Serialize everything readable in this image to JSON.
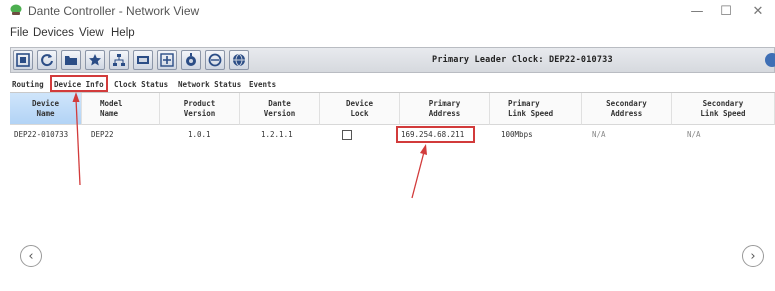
{
  "window": {
    "title": "Dante Controller - Network View",
    "minimize_glyph": "—",
    "maximize_glyph": "☐",
    "close_glyph": "✕"
  },
  "menu": [
    "File",
    "Devices",
    "View",
    "Help"
  ],
  "toolbar": {
    "leader_clock": "Primary Leader Clock: DEP22-010733",
    "buttons": [
      "device-view-icon",
      "refresh-icon",
      "folder-icon",
      "favorite-star-icon",
      "network-tree-icon",
      "presets-icon",
      "add-icon",
      "domain-icon",
      "clock-icon",
      "globe-icon"
    ]
  },
  "tabs": [
    "Routing",
    "Device Info",
    "Clock Status",
    "Network Status",
    "Events"
  ],
  "active_tab": "Device Info",
  "table": {
    "headers": [
      "Device\nName",
      "Model\nName",
      "Product\nVersion",
      "Dante\nVersion",
      "Device\nLock",
      "Primary\nAddress",
      "Primary\nLink Speed",
      "Secondary\nAddress",
      "Secondary\nLink Speed"
    ],
    "row": {
      "device_name": "DEP22-010733",
      "model_name": "DEP22",
      "product_version": "1.0.1",
      "dante_version": "1.2.1.1",
      "device_lock": false,
      "primary_address": "169.254.68.211",
      "primary_link_speed": "100Mbps",
      "secondary_address": "N/A",
      "secondary_link_speed": "N/A"
    }
  },
  "nav": {
    "prev_glyph": "‹",
    "next_glyph": "›"
  },
  "colors": {
    "annotation_red": "#d23b3b",
    "selected_header": "#b2d3f5",
    "toolbar_bg": "#d6d9de"
  }
}
